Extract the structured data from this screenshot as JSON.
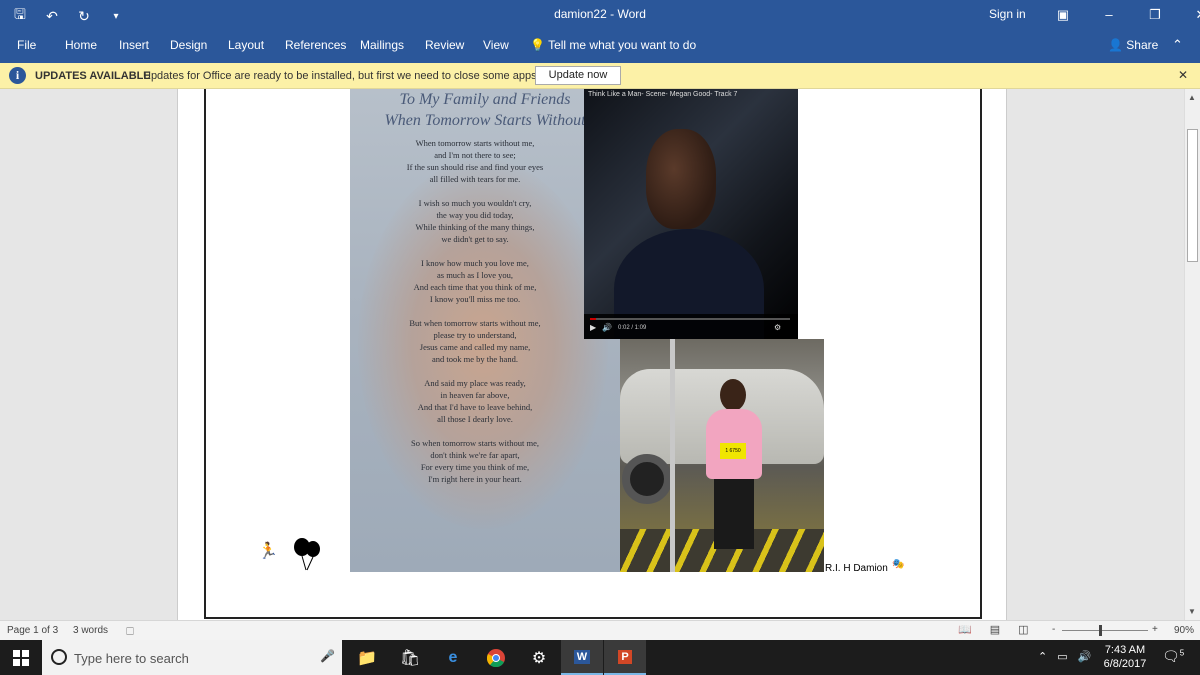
{
  "titlebar": {
    "document": "damion22",
    "separator": "-",
    "app": "Word",
    "sign_in": "Sign in",
    "qat_icons": [
      "save-icon",
      "undo-icon",
      "redo-icon",
      "customize-icon"
    ]
  },
  "ribbon": {
    "tabs": [
      "File",
      "Home",
      "Insert",
      "Design",
      "Layout",
      "References",
      "Mailings",
      "Review",
      "View"
    ],
    "tell_me": "Tell me what you want to do",
    "share": "Share"
  },
  "updates_bar": {
    "title": "UPDATES AVAILABLE",
    "message": "Updates for Office are ready to be installed, but first we need to close some apps.",
    "button": "Update now"
  },
  "document": {
    "poem_title": [
      "To My Family and Friends",
      "When Tomorrow Starts Without"
    ],
    "poem_stanzas": [
      [
        "When tomorrow starts without me,",
        "and I'm not there to see;",
        "If the sun should rise and find your eyes",
        "all filled with tears for me."
      ],
      [
        "I wish so much you wouldn't cry,",
        "the way you did today,",
        "While thinking of the many things,",
        "we didn't get to say."
      ],
      [
        "I know how much you love me,",
        "as much as I love you,",
        "And each time that you think of me,",
        "I know you'll miss me too."
      ],
      [
        "But when tomorrow starts without me,",
        "please try to understand,",
        "Jesus came and called my name,",
        "and took me by the hand."
      ],
      [
        "And said my place was ready,",
        "in heaven far above,",
        "And that I'd have to leave behind,",
        "all those I dearly love."
      ],
      [
        "So when tomorrow starts without me,",
        "don't think we're far apart,",
        "For every time you think of me,",
        "I'm right here in your heart."
      ]
    ],
    "video_title": "Think Like a Man- Scene- Megan Good- Track 7",
    "video_time": "0:02 / 1:09",
    "video_progress": 0.03,
    "bib_number": "1 6750",
    "caption": "R.I. H Damion"
  },
  "status": {
    "page": "Page 1 of 3",
    "words": "3 words",
    "zoom_minus": "-",
    "zoom_plus": "+",
    "zoom": "90%"
  },
  "taskbar": {
    "search_placeholder": "Type here to search",
    "time": "7:43 AM",
    "date": "6/8/2017",
    "notifications": "5",
    "apps": [
      "file-explorer",
      "store",
      "edge",
      "chrome",
      "settings",
      "word",
      "powerpoint"
    ]
  },
  "colors": {
    "ribbon": "#2b579a",
    "updates_bar": "#fcf1a7",
    "taskbar": "#1c1c1c"
  }
}
